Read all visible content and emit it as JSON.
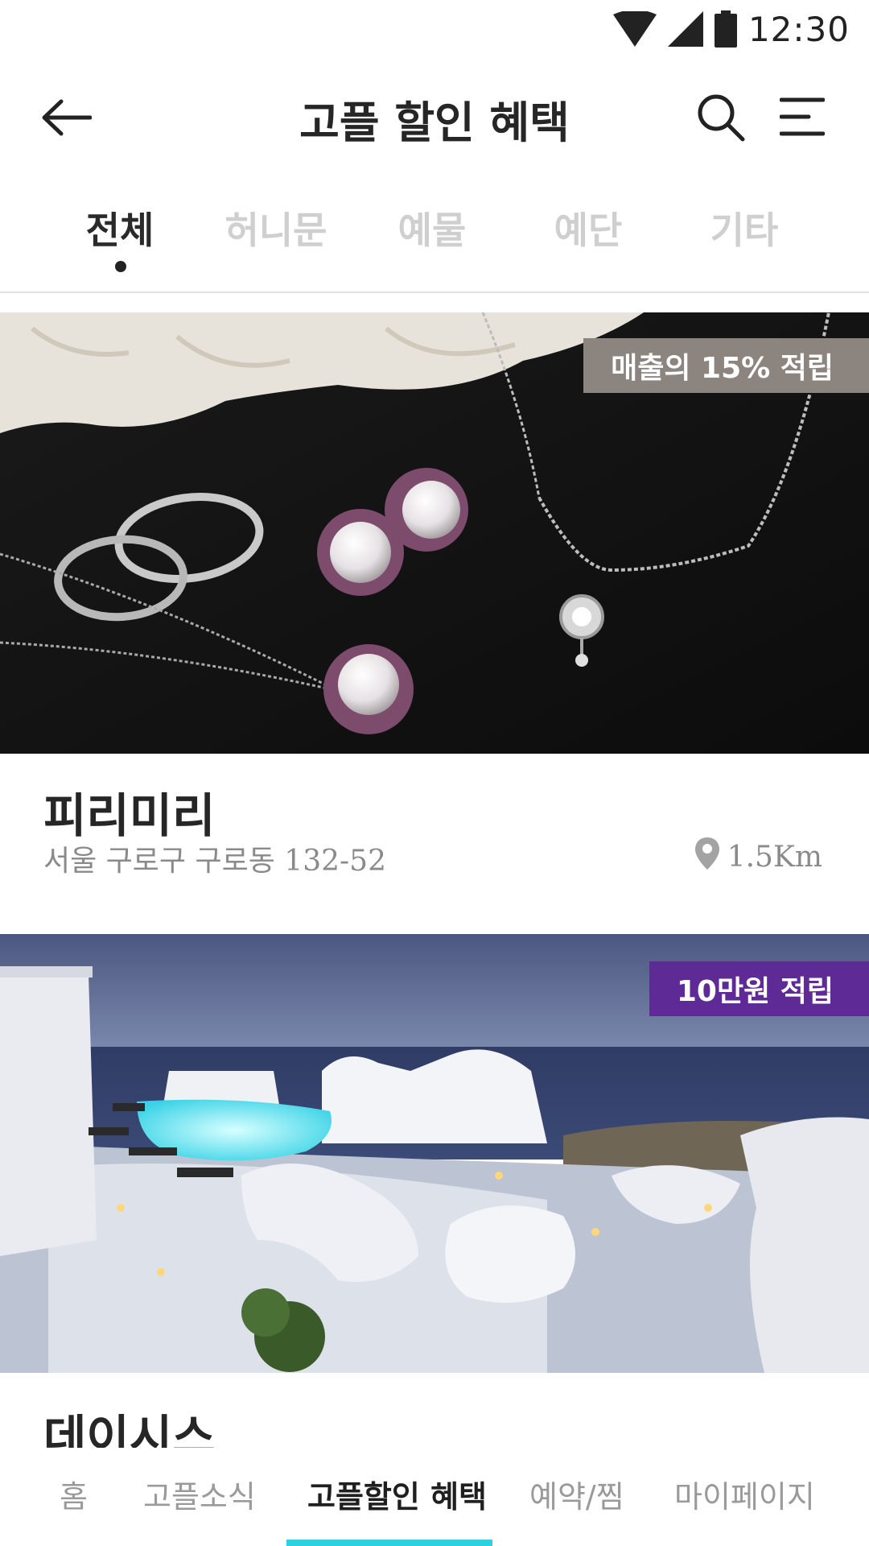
{
  "status_bar": {
    "time": "12:30",
    "icons": [
      "wifi-icon",
      "cell-signal-icon",
      "battery-icon"
    ]
  },
  "header": {
    "title": "고플 할인 혜택",
    "icons": [
      "back-arrow-icon",
      "search-icon",
      "menu-icon"
    ]
  },
  "category_tabs": [
    {
      "label": "전체",
      "active": true
    },
    {
      "label": "허니문",
      "active": false
    },
    {
      "label": "예물",
      "active": false
    },
    {
      "label": "예단",
      "active": false
    },
    {
      "label": "기타",
      "active": false
    }
  ],
  "listings": [
    {
      "name": "피리미리",
      "address": "서울 구로구 구로동 132-52",
      "distance": "1.5Km",
      "badge": "매출의 15% 적립",
      "badge_color": "#8c847e"
    },
    {
      "name": "데이시스",
      "badge": "10만원 적립",
      "badge_color": "#5e2a96"
    }
  ],
  "bottom_nav": [
    {
      "label": "홈",
      "active": false
    },
    {
      "label": "고플소식",
      "active": false
    },
    {
      "label": "고플할인 혜택",
      "active": true
    },
    {
      "label": "예약/찜",
      "active": false
    },
    {
      "label": "마이페이지",
      "active": false
    }
  ],
  "colors": {
    "accent": "#2ed0de",
    "text_primary": "#262626",
    "text_secondary": "#8a8a8a",
    "tab_inactive": "#cfcfcf"
  }
}
